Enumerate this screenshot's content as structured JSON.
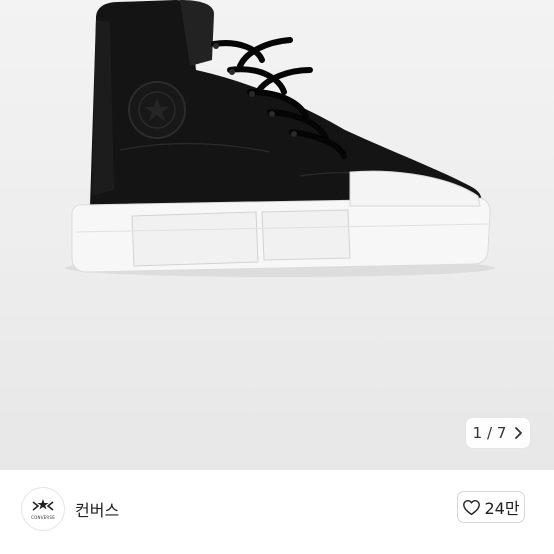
{
  "gallery": {
    "image_alt_icon": "high-top-sneaker-image",
    "pager": {
      "current": "1",
      "separator": "/",
      "total": "7",
      "next_icon": "chevron-right-icon"
    }
  },
  "brand": {
    "logo_icon": "converse-star-chevron-logo",
    "logo_word": "CONVERSE",
    "name": "컨버스",
    "like_icon": "heart-outline-icon",
    "like_count": "24만"
  }
}
